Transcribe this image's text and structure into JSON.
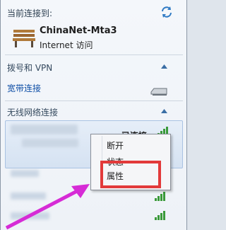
{
  "header": {
    "label": "当前连接到:",
    "refresh_icon": "refresh-arrows-icon"
  },
  "current_network": {
    "name": "ChinaNet-Mta3",
    "access": "Internet 访问",
    "icon": "bench-network-icon"
  },
  "sections": {
    "dialup": {
      "title": "拨号和 VPN",
      "item": "宽带连接"
    },
    "wireless": {
      "title": "无线网络连接"
    }
  },
  "wifi_list": {
    "status": "已连接"
  },
  "context_menu": {
    "items": [
      "断开",
      "状态",
      "属性"
    ]
  },
  "colors": {
    "highlight": "#e23a3a",
    "arrow": "#d62bd6",
    "signal": "#3a9a3a",
    "link": "#0e4ea6"
  }
}
